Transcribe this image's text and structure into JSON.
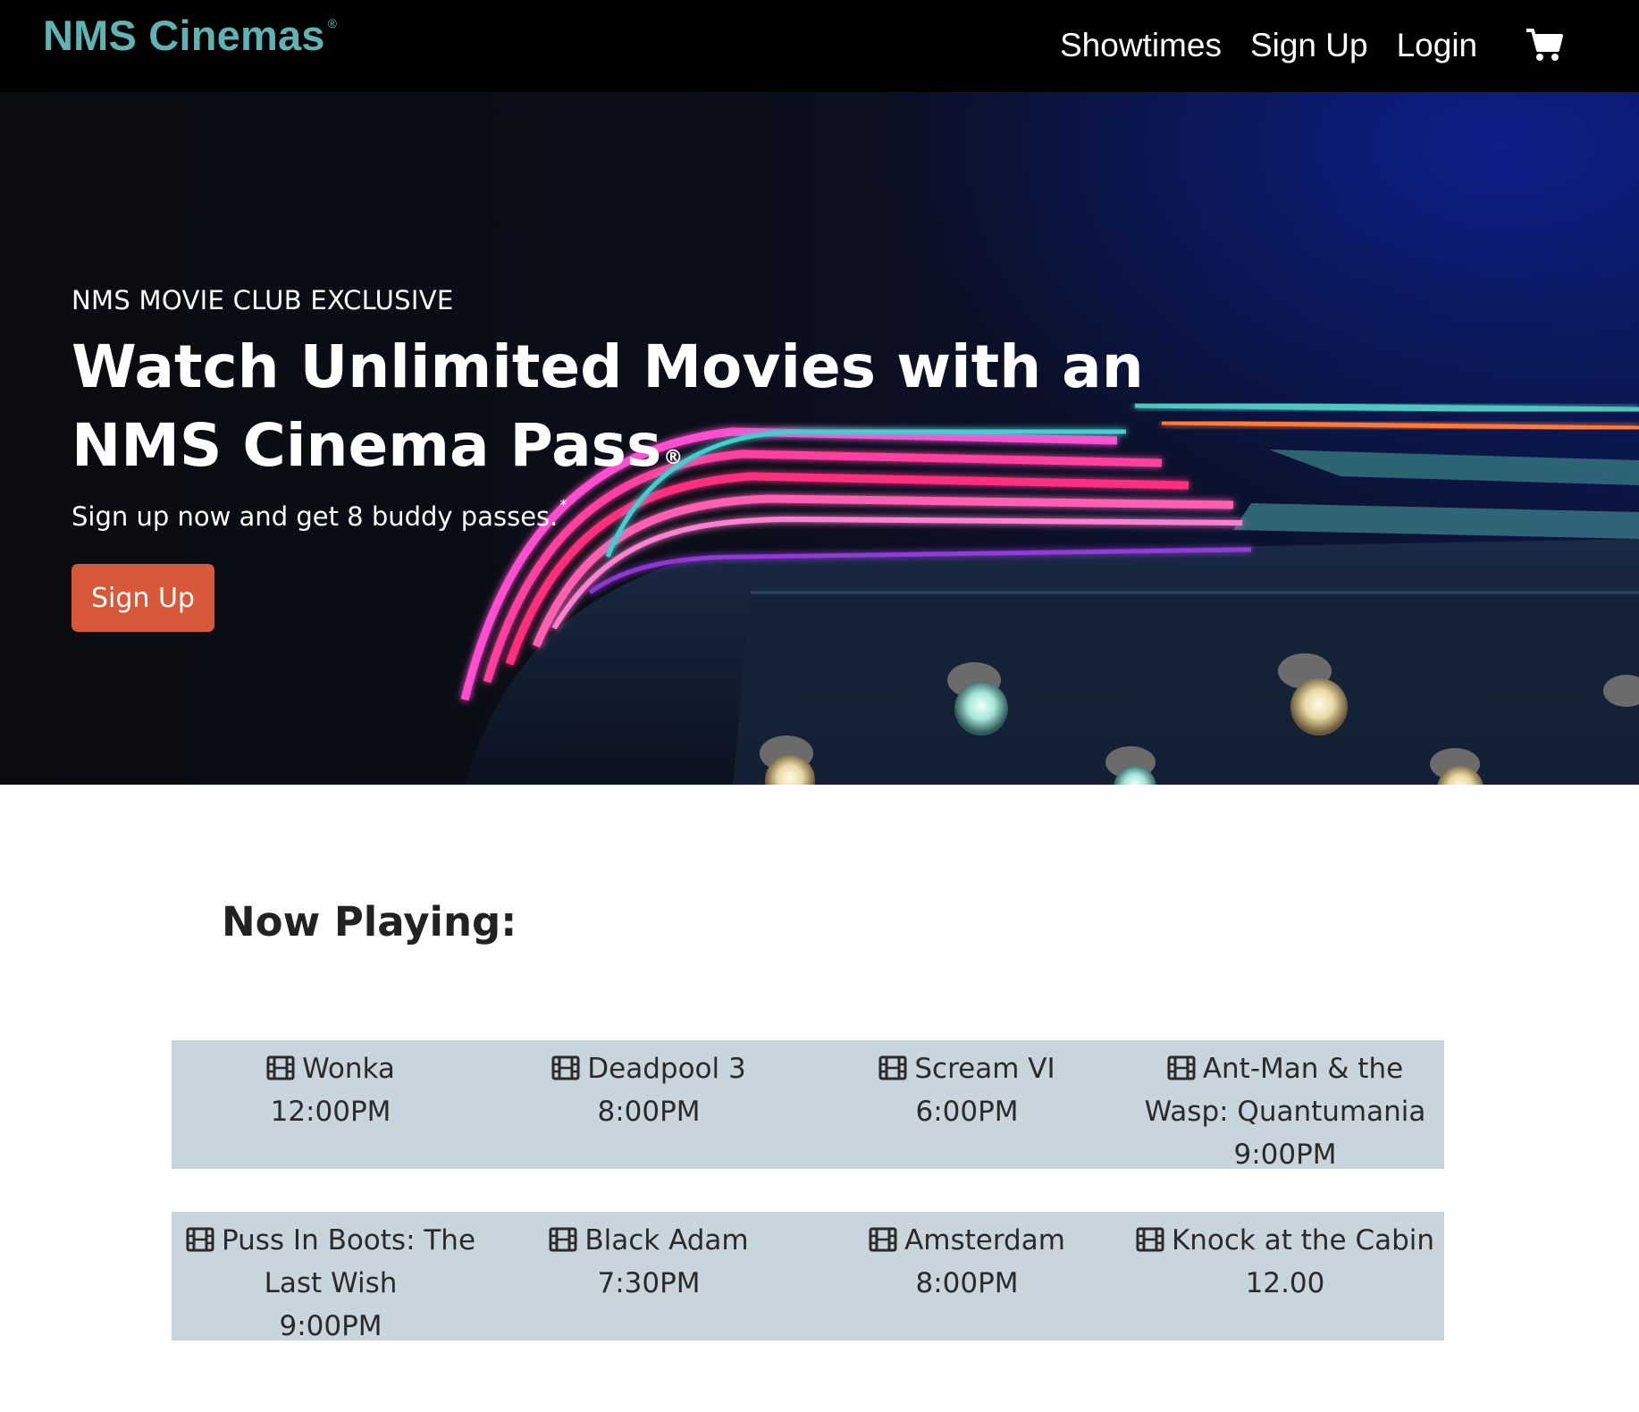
{
  "nav": {
    "brand": "NMS Cinemas",
    "brand_mark": "®",
    "links": [
      "Showtimes",
      "Sign Up",
      "Login"
    ],
    "cart_icon": "shopping-cart-icon"
  },
  "hero": {
    "eyebrow": "NMS MOVIE CLUB EXCLUSIVE",
    "headline": "Watch Unlimited Movies with an NMS Cinema Pass",
    "headline_mark": "®",
    "subline": "Sign up now and get 8 buddy passes.",
    "subline_mark": "*",
    "cta_label": "Sign Up",
    "cta_color": "#d8583a"
  },
  "now_playing": {
    "title": "Now Playing:",
    "icon": "film-icon",
    "movies": [
      {
        "title": "Wonka",
        "time": "12:00PM"
      },
      {
        "title": "Deadpool 3",
        "time": "8:00PM"
      },
      {
        "title": "Scream VI",
        "time": "6:00PM"
      },
      {
        "title": "Ant-Man & the Wasp: Quantumania",
        "time": "9:00PM"
      },
      {
        "title": "Puss In Boots: The Last Wish",
        "time": "9:00PM"
      },
      {
        "title": "Black Adam",
        "time": "7:30PM"
      },
      {
        "title": "Amsterdam",
        "time": "8:00PM"
      },
      {
        "title": "Knock at the Cabin",
        "time": "12.00"
      }
    ]
  },
  "colors": {
    "brand": "#5fb3b3",
    "nav_bg": "#000000",
    "row_bg": "#c9d5dd",
    "cta": "#d8583a"
  }
}
